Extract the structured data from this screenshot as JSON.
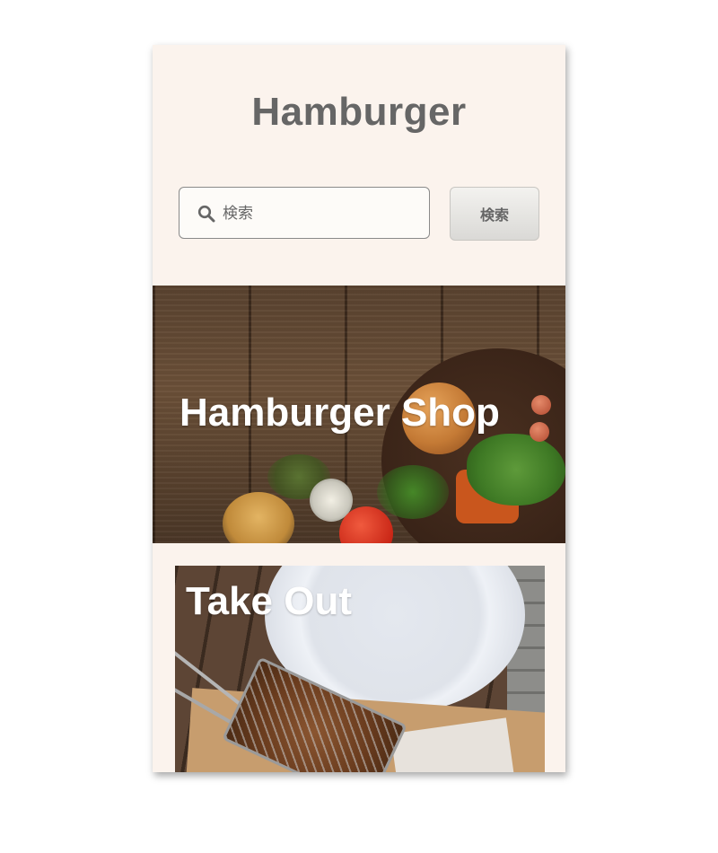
{
  "header": {
    "site_title": "Hamburger"
  },
  "search": {
    "placeholder": "検索",
    "button_label": "検索",
    "icon": "search-icon"
  },
  "hero": {
    "title": "Hamburger Shop"
  },
  "cards": [
    {
      "title": "Take Out"
    }
  ],
  "colors": {
    "header_background": "#fbf3ed",
    "title_text": "#666666",
    "overlay_text": "#ffffff"
  }
}
